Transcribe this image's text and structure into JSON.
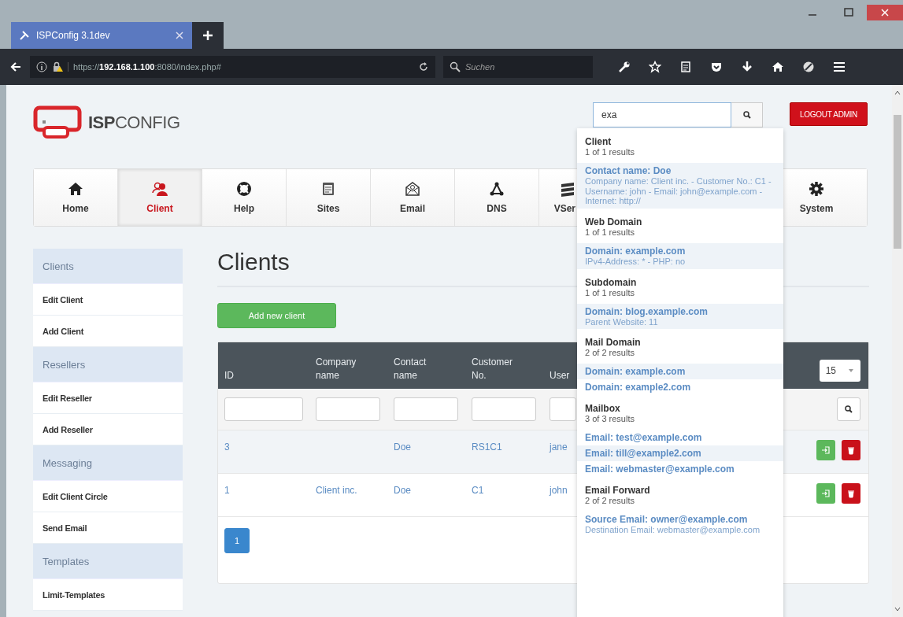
{
  "browser": {
    "tab_title": "ISPConfig 3.1dev",
    "url": "https://**192.168.1.100**:8080/index.php#",
    "search_placeholder": "Suchen"
  },
  "header": {
    "logo_bold": "ISP",
    "logo_light": "CONFIG",
    "search_value": "exa",
    "logout": "LOGOUT ADMIN"
  },
  "nav": [
    {
      "label": "Home",
      "kind": "home",
      "selected": false
    },
    {
      "label": "Client",
      "kind": "client",
      "selected": true
    },
    {
      "label": "Help",
      "kind": "help",
      "selected": false
    },
    {
      "label": "Sites",
      "kind": "sites",
      "selected": false
    },
    {
      "label": "Email",
      "kind": "email",
      "selected": false
    },
    {
      "label": "DNS",
      "kind": "dns",
      "selected": false
    },
    {
      "label": "VSer",
      "kind": "vserver",
      "selected": false
    },
    {
      "label": "System",
      "kind": "system",
      "selected": false
    }
  ],
  "sidebar": [
    {
      "title": "Clients",
      "items": [
        "Edit Client",
        "Add Client"
      ]
    },
    {
      "title": "Resellers",
      "items": [
        "Edit Reseller",
        "Add Reseller"
      ]
    },
    {
      "title": "Messaging",
      "items": [
        "Edit Client Circle",
        "Send Email"
      ]
    },
    {
      "title": "Templates",
      "items": [
        "Limit-Templates"
      ]
    }
  ],
  "page_title": "Clients",
  "add_button": "Add new client",
  "table": {
    "columns": [
      "ID",
      "Company name",
      "Contact name",
      "Customer No.",
      "User"
    ],
    "page_size": "15",
    "rows": [
      [
        "3",
        "",
        "Doe",
        "RS1C1",
        "jane"
      ],
      [
        "1",
        "Client inc.",
        "Doe",
        "C1",
        "john"
      ]
    ],
    "pages": [
      {
        "label": "1",
        "selected": true
      }
    ]
  },
  "search_results": [
    {
      "title": "Client",
      "count": "1 of 1 results",
      "results": [
        {
          "title": "Contact name: Doe",
          "detail": "Company name: Client inc. - Customer No.: C1 - Username: john - Email: john@example.com - Internet: http://",
          "shaded": true
        }
      ]
    },
    {
      "title": "Web Domain",
      "count": "1 of 1 results",
      "results": [
        {
          "title": "Domain: example.com",
          "detail": "IPv4-Address: * - PHP: no",
          "shaded": true
        }
      ]
    },
    {
      "title": "Subdomain",
      "count": "1 of 1 results",
      "results": [
        {
          "title": "Domain: blog.example.com",
          "detail": "Parent Website: 11",
          "shaded": true
        }
      ]
    },
    {
      "title": "Mail Domain",
      "count": "2 of 2 results",
      "results": [
        {
          "title": "Domain: example.com",
          "shaded": true
        },
        {
          "title": "Domain: example2.com",
          "shaded": false
        }
      ]
    },
    {
      "title": "Mailbox",
      "count": "3 of 3 results",
      "results": [
        {
          "title": "Email: test@example.com",
          "shaded": false
        },
        {
          "title": "Email: till@example2.com",
          "shaded": true
        },
        {
          "title": "Email: webmaster@example.com",
          "shaded": false
        }
      ]
    },
    {
      "title": "Email Forward",
      "count": "2 of 2 results",
      "results": [
        {
          "title": "Source Email: owner@example.com",
          "detail": "Destination Email: webmaster@example.com",
          "shaded": false
        }
      ]
    }
  ]
}
